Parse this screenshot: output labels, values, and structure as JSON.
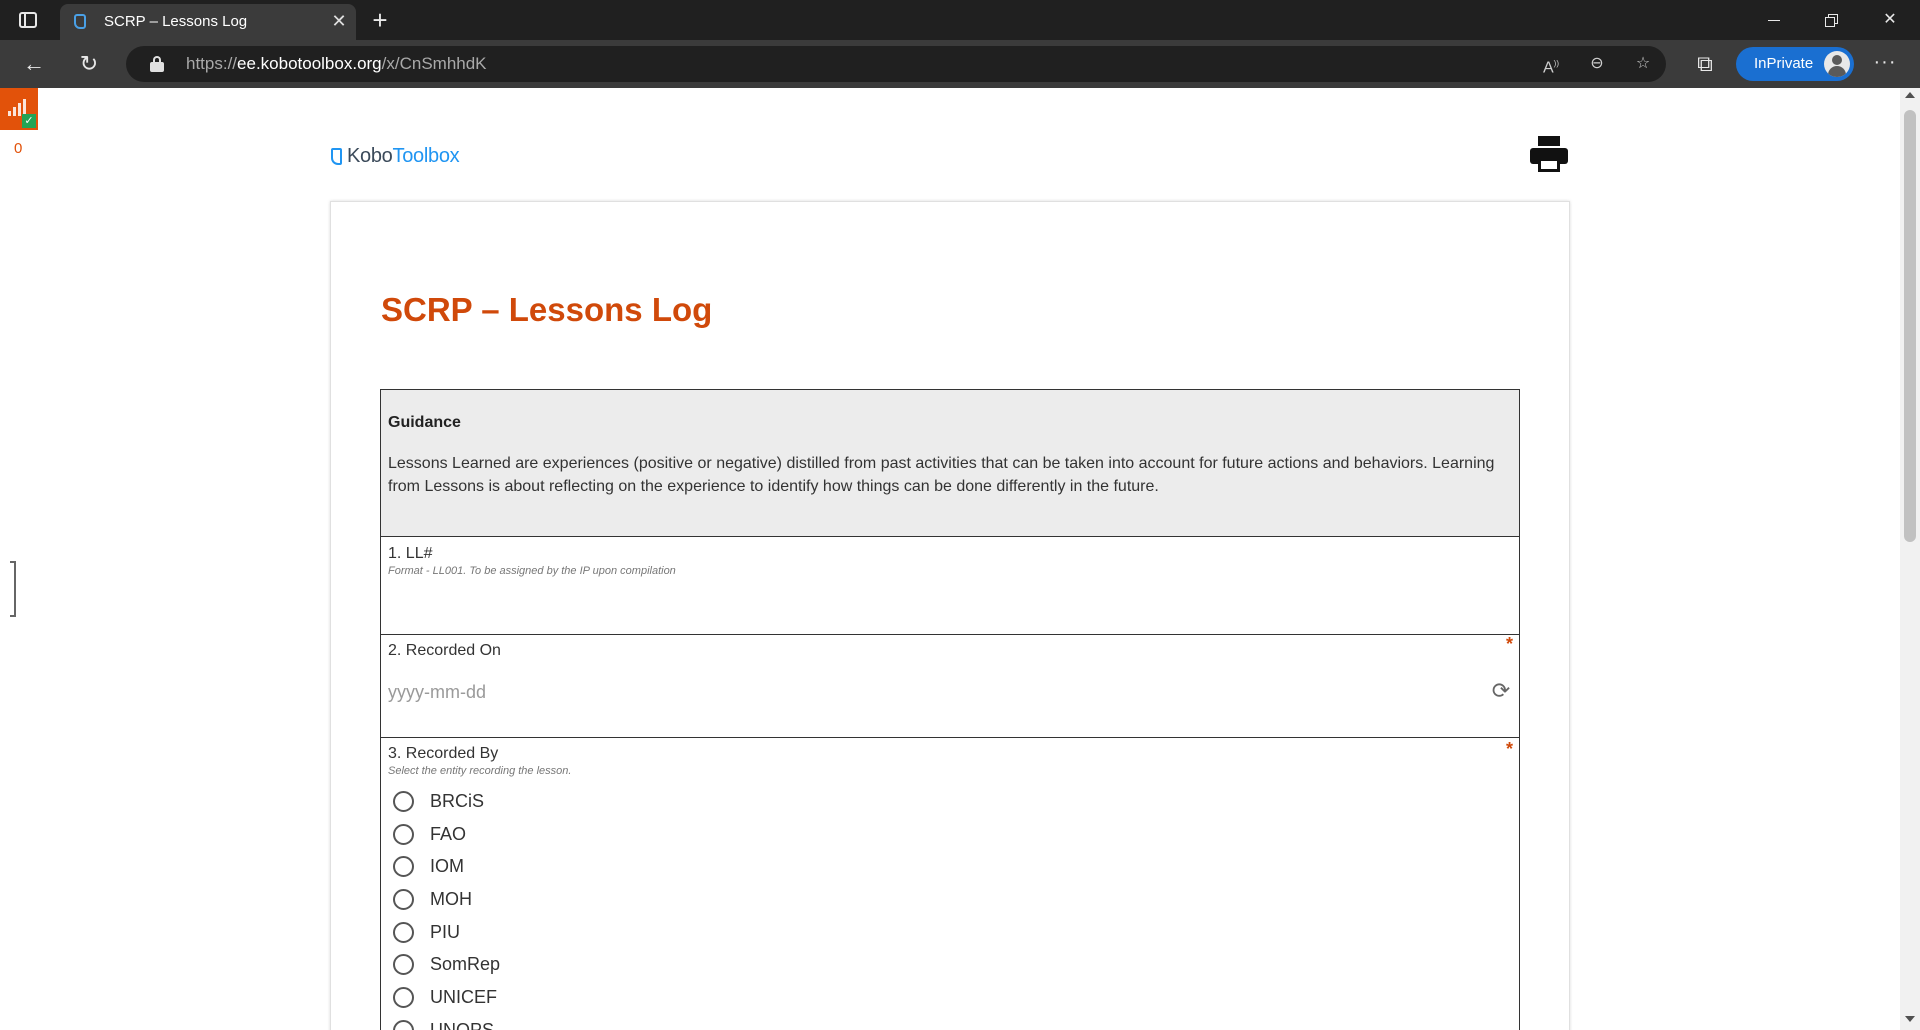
{
  "browser": {
    "tab_title": "SCRP – Lessons Log",
    "url_scheme": "https://",
    "url_host": "ee.kobotoolbox.org",
    "url_path": "/x/CnSmhhdK",
    "inprivate_label": "InPrivate"
  },
  "side": {
    "count": "0"
  },
  "logo": {
    "part1": "Kobo",
    "part2": "Toolbox"
  },
  "form": {
    "title": "SCRP – Lessons Log",
    "guidance": {
      "heading": "Guidance",
      "text": "Lessons Learned are experiences (positive or negative) distilled from past activities that can be taken into account for future actions and behaviors. Learning from Lessons is about reflecting on the experience to identify how things can be done differently in the future."
    },
    "questions": [
      {
        "label": "1. LL#",
        "hint": "Format - LL001. To be assigned by the IP upon compilation"
      },
      {
        "label": "2. Recorded On",
        "required": "*",
        "placeholder": "yyyy-mm-dd"
      },
      {
        "label": "3. Recorded By",
        "required": "*",
        "hint": "Select the entity recording the lesson.",
        "options": [
          "BRCiS",
          "FAO",
          "IOM",
          "MOH",
          "PIU",
          "SomRep",
          "UNICEF",
          "UNOPS"
        ]
      }
    ]
  },
  "colors": {
    "accent": "#d0490a",
    "brand_blue": "#2095f2",
    "inprivate": "#1a6fd1"
  }
}
